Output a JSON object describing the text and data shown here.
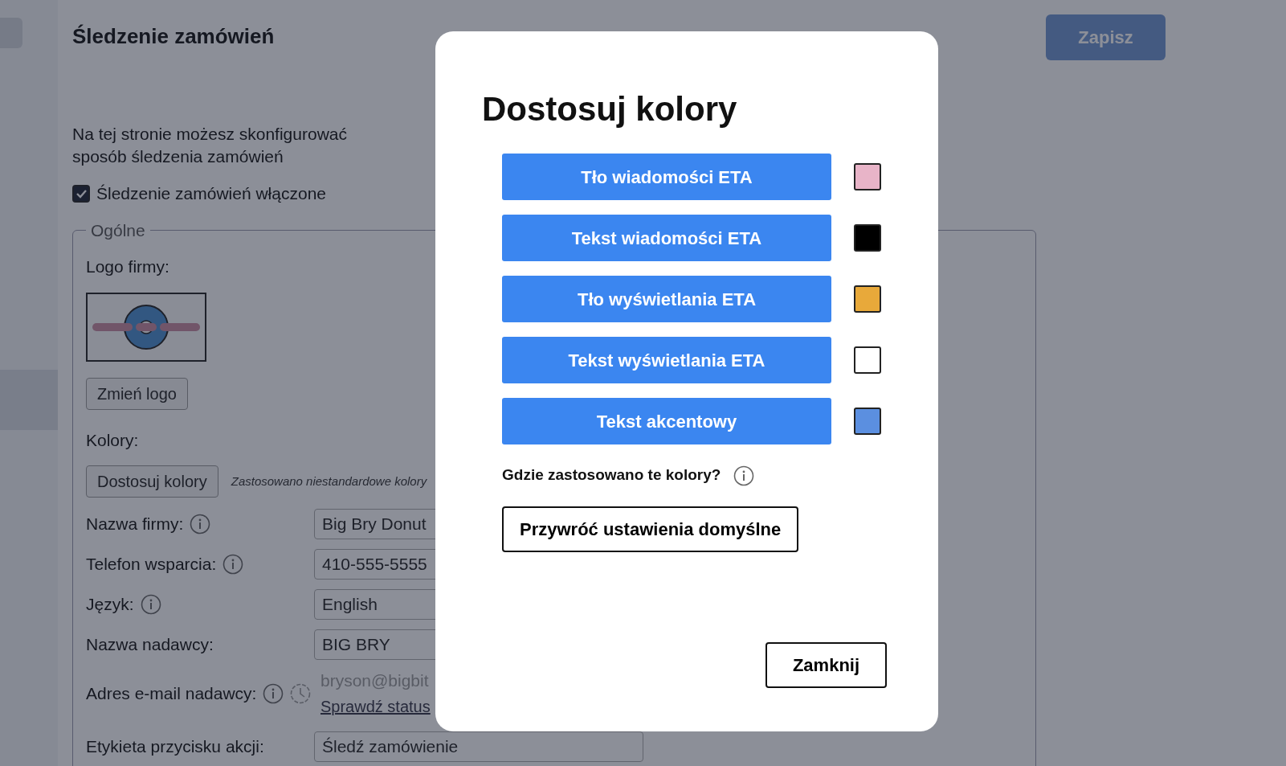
{
  "sidebar": {
    "items": [
      {
        "selected": false
      },
      {
        "selected": true
      }
    ]
  },
  "page": {
    "title": "Śledzenie zamówień",
    "save_button": {
      "label": "Zapisz",
      "disabled": true
    },
    "description": "Na tej stronie możesz skonfigurować sposób śledzenia zamówień",
    "tracking_enabled": {
      "label": "Śledzenie zamówień włączone",
      "checked": true
    }
  },
  "general": {
    "legend": "Ogólne",
    "logo_label": "Logo firmy:",
    "change_logo_button": "Zmień logo",
    "colors_label": "Kolory:",
    "customize_button": "Dostosuj kolory",
    "colors_note": "Zastosowano niestandardowe kolory",
    "fields": [
      {
        "kind": "input",
        "label": "Nazwa firmy:",
        "info": true,
        "value": "Big Bry Donut"
      },
      {
        "kind": "input",
        "label": "Telefon wsparcia:",
        "info": true,
        "value": "410-555-5555"
      },
      {
        "kind": "input",
        "label": "Język:",
        "info": true,
        "value": "English"
      },
      {
        "kind": "input",
        "label": "Nazwa nadawcy:",
        "info": false,
        "value": "BIG BRY"
      },
      {
        "kind": "email",
        "label": "Adres e-mail nadawcy:",
        "info": true,
        "value": "bryson@bigbit",
        "link": "Sprawdź status"
      },
      {
        "kind": "input",
        "label": "Etykieta przycisku akcji:",
        "info": false,
        "value": "Śledź zamówienie"
      }
    ]
  },
  "modal": {
    "title": "Dostosuj kolory",
    "color_buttons": [
      {
        "label": "Tło wiadomości ETA",
        "color": "#e8b4c8"
      },
      {
        "label": "Tekst wiadomości ETA",
        "color": "#000000"
      },
      {
        "label": "Tło wyświetlania ETA",
        "color": "#e8a93a"
      },
      {
        "label": "Tekst wyświetlania ETA",
        "color": "#ffffff"
      },
      {
        "label": "Tekst akcentowy",
        "color": "#5b8fe0"
      }
    ],
    "help_text": "Gdzie zastosowano te kolory?",
    "reset_button": "Przywróć ustawienia domyślne",
    "close_button": "Zamknij"
  }
}
